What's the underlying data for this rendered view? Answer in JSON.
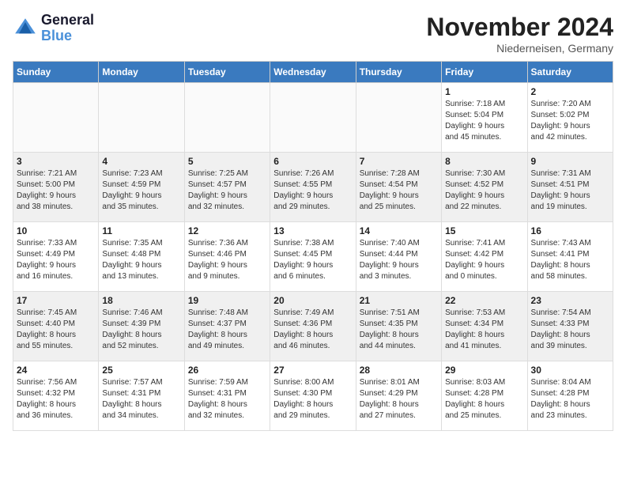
{
  "logo": {
    "general": "General",
    "blue": "Blue"
  },
  "title": "November 2024",
  "location": "Niederneisen, Germany",
  "days_of_week": [
    "Sunday",
    "Monday",
    "Tuesday",
    "Wednesday",
    "Thursday",
    "Friday",
    "Saturday"
  ],
  "weeks": [
    [
      {
        "day": "",
        "info": ""
      },
      {
        "day": "",
        "info": ""
      },
      {
        "day": "",
        "info": ""
      },
      {
        "day": "",
        "info": ""
      },
      {
        "day": "",
        "info": ""
      },
      {
        "day": "1",
        "info": "Sunrise: 7:18 AM\nSunset: 5:04 PM\nDaylight: 9 hours\nand 45 minutes."
      },
      {
        "day": "2",
        "info": "Sunrise: 7:20 AM\nSunset: 5:02 PM\nDaylight: 9 hours\nand 42 minutes."
      }
    ],
    [
      {
        "day": "3",
        "info": "Sunrise: 7:21 AM\nSunset: 5:00 PM\nDaylight: 9 hours\nand 38 minutes."
      },
      {
        "day": "4",
        "info": "Sunrise: 7:23 AM\nSunset: 4:59 PM\nDaylight: 9 hours\nand 35 minutes."
      },
      {
        "day": "5",
        "info": "Sunrise: 7:25 AM\nSunset: 4:57 PM\nDaylight: 9 hours\nand 32 minutes."
      },
      {
        "day": "6",
        "info": "Sunrise: 7:26 AM\nSunset: 4:55 PM\nDaylight: 9 hours\nand 29 minutes."
      },
      {
        "day": "7",
        "info": "Sunrise: 7:28 AM\nSunset: 4:54 PM\nDaylight: 9 hours\nand 25 minutes."
      },
      {
        "day": "8",
        "info": "Sunrise: 7:30 AM\nSunset: 4:52 PM\nDaylight: 9 hours\nand 22 minutes."
      },
      {
        "day": "9",
        "info": "Sunrise: 7:31 AM\nSunset: 4:51 PM\nDaylight: 9 hours\nand 19 minutes."
      }
    ],
    [
      {
        "day": "10",
        "info": "Sunrise: 7:33 AM\nSunset: 4:49 PM\nDaylight: 9 hours\nand 16 minutes."
      },
      {
        "day": "11",
        "info": "Sunrise: 7:35 AM\nSunset: 4:48 PM\nDaylight: 9 hours\nand 13 minutes."
      },
      {
        "day": "12",
        "info": "Sunrise: 7:36 AM\nSunset: 4:46 PM\nDaylight: 9 hours\nand 9 minutes."
      },
      {
        "day": "13",
        "info": "Sunrise: 7:38 AM\nSunset: 4:45 PM\nDaylight: 9 hours\nand 6 minutes."
      },
      {
        "day": "14",
        "info": "Sunrise: 7:40 AM\nSunset: 4:44 PM\nDaylight: 9 hours\nand 3 minutes."
      },
      {
        "day": "15",
        "info": "Sunrise: 7:41 AM\nSunset: 4:42 PM\nDaylight: 9 hours\nand 0 minutes."
      },
      {
        "day": "16",
        "info": "Sunrise: 7:43 AM\nSunset: 4:41 PM\nDaylight: 8 hours\nand 58 minutes."
      }
    ],
    [
      {
        "day": "17",
        "info": "Sunrise: 7:45 AM\nSunset: 4:40 PM\nDaylight: 8 hours\nand 55 minutes."
      },
      {
        "day": "18",
        "info": "Sunrise: 7:46 AM\nSunset: 4:39 PM\nDaylight: 8 hours\nand 52 minutes."
      },
      {
        "day": "19",
        "info": "Sunrise: 7:48 AM\nSunset: 4:37 PM\nDaylight: 8 hours\nand 49 minutes."
      },
      {
        "day": "20",
        "info": "Sunrise: 7:49 AM\nSunset: 4:36 PM\nDaylight: 8 hours\nand 46 minutes."
      },
      {
        "day": "21",
        "info": "Sunrise: 7:51 AM\nSunset: 4:35 PM\nDaylight: 8 hours\nand 44 minutes."
      },
      {
        "day": "22",
        "info": "Sunrise: 7:53 AM\nSunset: 4:34 PM\nDaylight: 8 hours\nand 41 minutes."
      },
      {
        "day": "23",
        "info": "Sunrise: 7:54 AM\nSunset: 4:33 PM\nDaylight: 8 hours\nand 39 minutes."
      }
    ],
    [
      {
        "day": "24",
        "info": "Sunrise: 7:56 AM\nSunset: 4:32 PM\nDaylight: 8 hours\nand 36 minutes."
      },
      {
        "day": "25",
        "info": "Sunrise: 7:57 AM\nSunset: 4:31 PM\nDaylight: 8 hours\nand 34 minutes."
      },
      {
        "day": "26",
        "info": "Sunrise: 7:59 AM\nSunset: 4:31 PM\nDaylight: 8 hours\nand 32 minutes."
      },
      {
        "day": "27",
        "info": "Sunrise: 8:00 AM\nSunset: 4:30 PM\nDaylight: 8 hours\nand 29 minutes."
      },
      {
        "day": "28",
        "info": "Sunrise: 8:01 AM\nSunset: 4:29 PM\nDaylight: 8 hours\nand 27 minutes."
      },
      {
        "day": "29",
        "info": "Sunrise: 8:03 AM\nSunset: 4:28 PM\nDaylight: 8 hours\nand 25 minutes."
      },
      {
        "day": "30",
        "info": "Sunrise: 8:04 AM\nSunset: 4:28 PM\nDaylight: 8 hours\nand 23 minutes."
      }
    ]
  ]
}
